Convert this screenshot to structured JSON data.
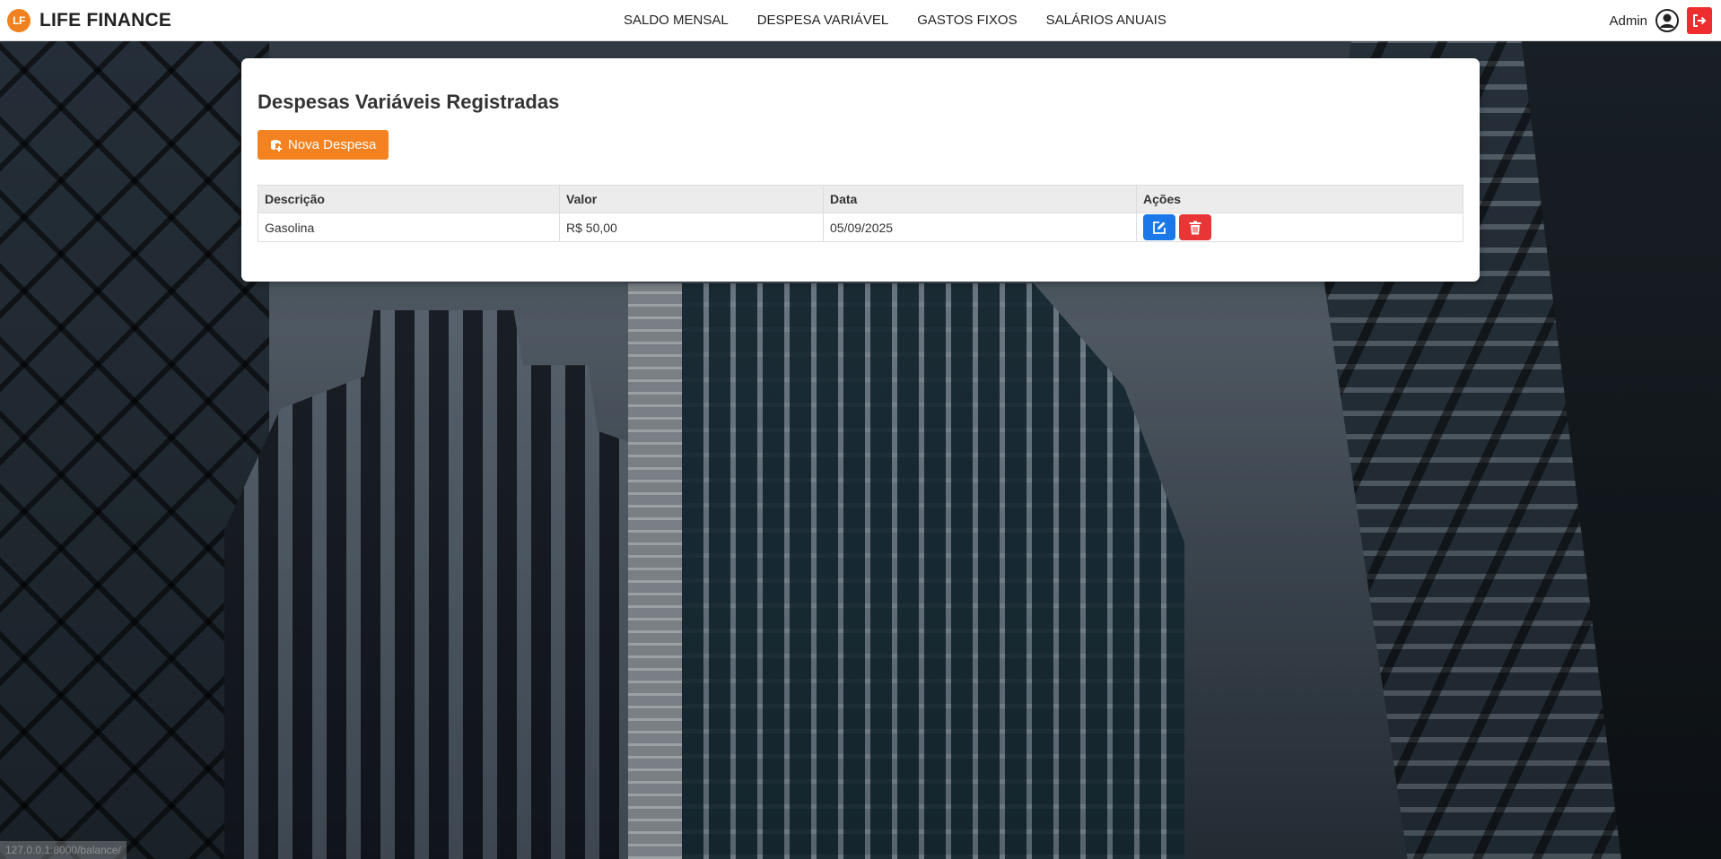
{
  "brand": {
    "logo_text": "LF",
    "name": "LIFE FINANCE",
    "accent_color": "#f0811e"
  },
  "nav": {
    "items": [
      {
        "label": "SALDO MENSAL"
      },
      {
        "label": "DESPESA VARIÁVEL"
      },
      {
        "label": "GASTOS FIXOS"
      },
      {
        "label": "SALÁRIOS ANUAIS"
      }
    ]
  },
  "user": {
    "name": "Admin",
    "icon": "user-circle-icon",
    "logout_icon": "logout-icon",
    "logout_color": "#ee2e2e"
  },
  "main": {
    "title": "Despesas Variáveis Registradas",
    "new_button": {
      "label": "Nova Despesa",
      "icon": "database-plus-icon",
      "color": "#f58220"
    },
    "table": {
      "headers": [
        "Descrição",
        "Valor",
        "Data",
        "Ações"
      ],
      "rows": [
        {
          "descricao": "Gasolina",
          "valor": "R$ 50,00",
          "data": "05/09/2025"
        }
      ],
      "action_buttons": {
        "edit": {
          "icon": "edit-icon",
          "color": "#1a78e8"
        },
        "delete": {
          "icon": "trash-icon",
          "color": "#e83535"
        }
      }
    }
  },
  "status_bar": {
    "url": "127.0.0.1:8000/balance/"
  }
}
